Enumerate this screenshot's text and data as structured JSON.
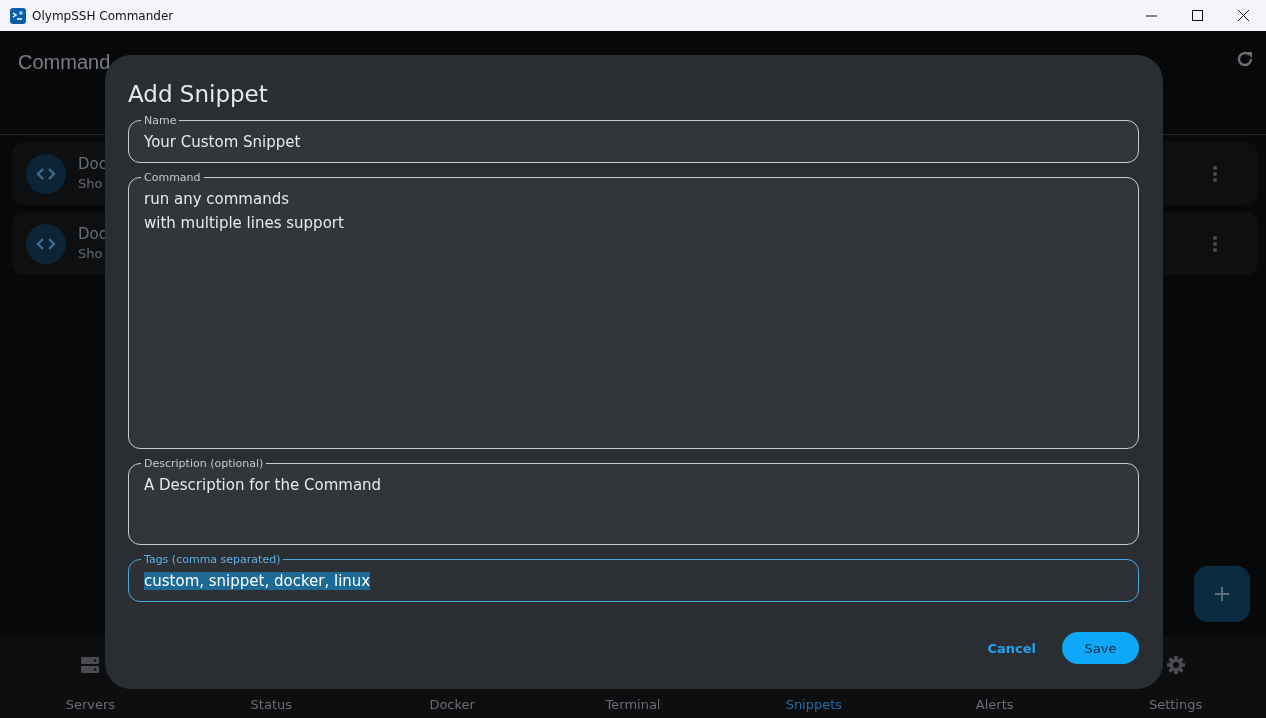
{
  "window": {
    "title": "OlympSSH Commander"
  },
  "header": {
    "title": "Command"
  },
  "list_items": [
    {
      "title": "Doc",
      "subtitle": "Sho"
    },
    {
      "title": "Doc",
      "subtitle": "Sho"
    }
  ],
  "bottom_nav": [
    {
      "label": "Servers",
      "selected": false
    },
    {
      "label": "Status",
      "selected": false
    },
    {
      "label": "Docker",
      "selected": false
    },
    {
      "label": "Terminal",
      "selected": false
    },
    {
      "label": "Snippets",
      "selected": true
    },
    {
      "label": "Alerts",
      "selected": false
    },
    {
      "label": "Settings",
      "selected": false
    }
  ],
  "dialog": {
    "title": "Add Snippet",
    "fields": [
      {
        "label": "Name",
        "value": "Your Custom Snippet",
        "kind": "input",
        "focused": false,
        "text_selected": false
      },
      {
        "label": "Command",
        "value": "run any commands\nwith multiple lines support",
        "kind": "textarea",
        "focused": false,
        "text_selected": false
      },
      {
        "label": "Description (optional)",
        "value": "A Description for the Command",
        "kind": "textarea",
        "focused": false,
        "text_selected": false
      },
      {
        "label": "Tags (comma separated)",
        "value": "custom, snippet, docker, linux",
        "kind": "input",
        "focused": true,
        "text_selected": true
      }
    ],
    "buttons": [
      {
        "label": "Cancel",
        "kind": "text"
      },
      {
        "label": "Save",
        "kind": "filled"
      }
    ]
  }
}
